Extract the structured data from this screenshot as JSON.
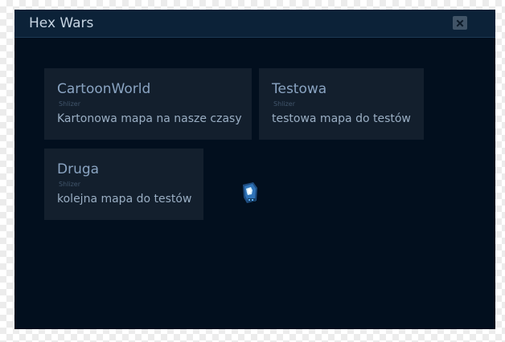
{
  "window": {
    "title": "Hex Wars"
  },
  "maps": [
    {
      "name": "CartoonWorld",
      "author": "Shlizer",
      "description": "Kartonowa mapa na nasze czasy"
    },
    {
      "name": "Testowa",
      "author": "Shlizer",
      "description": "testowa mapa do testów"
    },
    {
      "name": "Druga",
      "author": "Shlizer",
      "description": "kolejna mapa do testów"
    }
  ],
  "icons": {
    "close": "close-icon",
    "unit": "unit-sprite-icon"
  },
  "colors": {
    "window_bg": "#020f1e",
    "titlebar_bg": "#0c2238",
    "card_bg": "#131f2d",
    "card_title": "#8aa4c2",
    "accent": "#3a8fd9"
  }
}
